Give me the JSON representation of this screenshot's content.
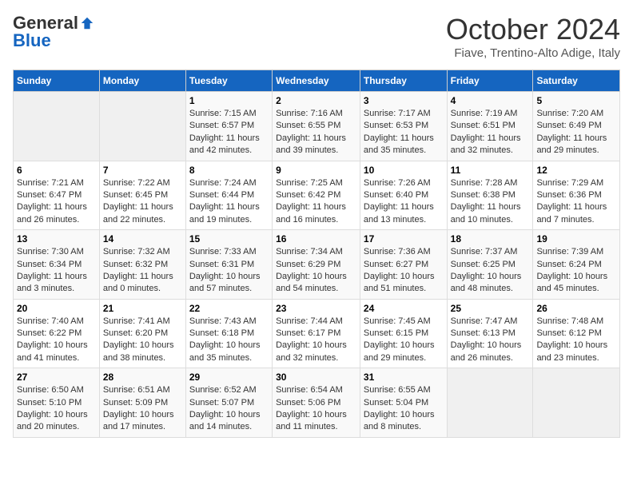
{
  "logo": {
    "general": "General",
    "blue": "Blue"
  },
  "title": "October 2024",
  "subtitle": "Fiave, Trentino-Alto Adige, Italy",
  "weekdays": [
    "Sunday",
    "Monday",
    "Tuesday",
    "Wednesday",
    "Thursday",
    "Friday",
    "Saturday"
  ],
  "weeks": [
    [
      {
        "day": "",
        "info": ""
      },
      {
        "day": "",
        "info": ""
      },
      {
        "day": "1",
        "info": "Sunrise: 7:15 AM\nSunset: 6:57 PM\nDaylight: 11 hours and 42 minutes."
      },
      {
        "day": "2",
        "info": "Sunrise: 7:16 AM\nSunset: 6:55 PM\nDaylight: 11 hours and 39 minutes."
      },
      {
        "day": "3",
        "info": "Sunrise: 7:17 AM\nSunset: 6:53 PM\nDaylight: 11 hours and 35 minutes."
      },
      {
        "day": "4",
        "info": "Sunrise: 7:19 AM\nSunset: 6:51 PM\nDaylight: 11 hours and 32 minutes."
      },
      {
        "day": "5",
        "info": "Sunrise: 7:20 AM\nSunset: 6:49 PM\nDaylight: 11 hours and 29 minutes."
      }
    ],
    [
      {
        "day": "6",
        "info": "Sunrise: 7:21 AM\nSunset: 6:47 PM\nDaylight: 11 hours and 26 minutes."
      },
      {
        "day": "7",
        "info": "Sunrise: 7:22 AM\nSunset: 6:45 PM\nDaylight: 11 hours and 22 minutes."
      },
      {
        "day": "8",
        "info": "Sunrise: 7:24 AM\nSunset: 6:44 PM\nDaylight: 11 hours and 19 minutes."
      },
      {
        "day": "9",
        "info": "Sunrise: 7:25 AM\nSunset: 6:42 PM\nDaylight: 11 hours and 16 minutes."
      },
      {
        "day": "10",
        "info": "Sunrise: 7:26 AM\nSunset: 6:40 PM\nDaylight: 11 hours and 13 minutes."
      },
      {
        "day": "11",
        "info": "Sunrise: 7:28 AM\nSunset: 6:38 PM\nDaylight: 11 hours and 10 minutes."
      },
      {
        "day": "12",
        "info": "Sunrise: 7:29 AM\nSunset: 6:36 PM\nDaylight: 11 hours and 7 minutes."
      }
    ],
    [
      {
        "day": "13",
        "info": "Sunrise: 7:30 AM\nSunset: 6:34 PM\nDaylight: 11 hours and 3 minutes."
      },
      {
        "day": "14",
        "info": "Sunrise: 7:32 AM\nSunset: 6:32 PM\nDaylight: 11 hours and 0 minutes."
      },
      {
        "day": "15",
        "info": "Sunrise: 7:33 AM\nSunset: 6:31 PM\nDaylight: 10 hours and 57 minutes."
      },
      {
        "day": "16",
        "info": "Sunrise: 7:34 AM\nSunset: 6:29 PM\nDaylight: 10 hours and 54 minutes."
      },
      {
        "day": "17",
        "info": "Sunrise: 7:36 AM\nSunset: 6:27 PM\nDaylight: 10 hours and 51 minutes."
      },
      {
        "day": "18",
        "info": "Sunrise: 7:37 AM\nSunset: 6:25 PM\nDaylight: 10 hours and 48 minutes."
      },
      {
        "day": "19",
        "info": "Sunrise: 7:39 AM\nSunset: 6:24 PM\nDaylight: 10 hours and 45 minutes."
      }
    ],
    [
      {
        "day": "20",
        "info": "Sunrise: 7:40 AM\nSunset: 6:22 PM\nDaylight: 10 hours and 41 minutes."
      },
      {
        "day": "21",
        "info": "Sunrise: 7:41 AM\nSunset: 6:20 PM\nDaylight: 10 hours and 38 minutes."
      },
      {
        "day": "22",
        "info": "Sunrise: 7:43 AM\nSunset: 6:18 PM\nDaylight: 10 hours and 35 minutes."
      },
      {
        "day": "23",
        "info": "Sunrise: 7:44 AM\nSunset: 6:17 PM\nDaylight: 10 hours and 32 minutes."
      },
      {
        "day": "24",
        "info": "Sunrise: 7:45 AM\nSunset: 6:15 PM\nDaylight: 10 hours and 29 minutes."
      },
      {
        "day": "25",
        "info": "Sunrise: 7:47 AM\nSunset: 6:13 PM\nDaylight: 10 hours and 26 minutes."
      },
      {
        "day": "26",
        "info": "Sunrise: 7:48 AM\nSunset: 6:12 PM\nDaylight: 10 hours and 23 minutes."
      }
    ],
    [
      {
        "day": "27",
        "info": "Sunrise: 6:50 AM\nSunset: 5:10 PM\nDaylight: 10 hours and 20 minutes."
      },
      {
        "day": "28",
        "info": "Sunrise: 6:51 AM\nSunset: 5:09 PM\nDaylight: 10 hours and 17 minutes."
      },
      {
        "day": "29",
        "info": "Sunrise: 6:52 AM\nSunset: 5:07 PM\nDaylight: 10 hours and 14 minutes."
      },
      {
        "day": "30",
        "info": "Sunrise: 6:54 AM\nSunset: 5:06 PM\nDaylight: 10 hours and 11 minutes."
      },
      {
        "day": "31",
        "info": "Sunrise: 6:55 AM\nSunset: 5:04 PM\nDaylight: 10 hours and 8 minutes."
      },
      {
        "day": "",
        "info": ""
      },
      {
        "day": "",
        "info": ""
      }
    ]
  ]
}
